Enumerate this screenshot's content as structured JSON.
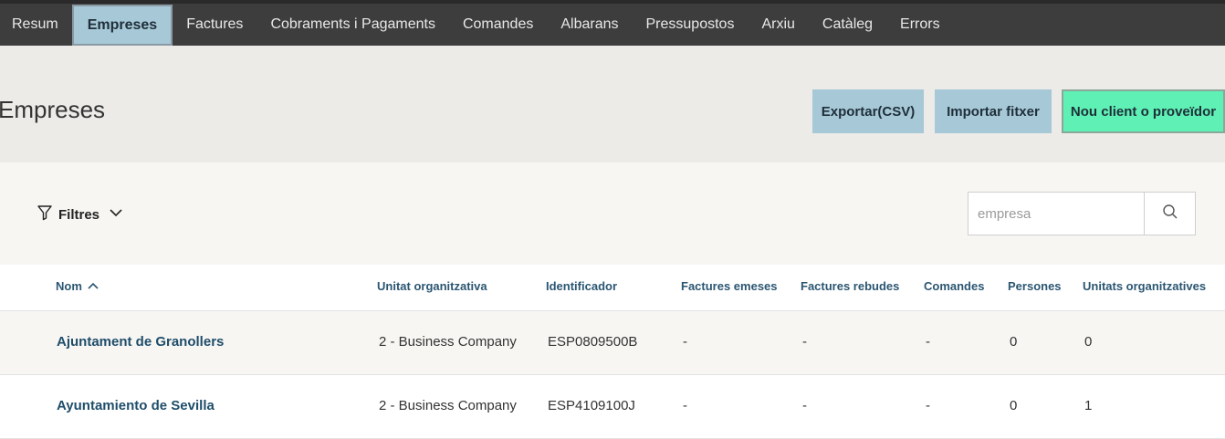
{
  "nav": {
    "items": [
      {
        "label": "Resum"
      },
      {
        "label": "Empreses"
      },
      {
        "label": "Factures"
      },
      {
        "label": "Cobraments i Pagaments"
      },
      {
        "label": "Comandes"
      },
      {
        "label": "Albarans"
      },
      {
        "label": "Pressupostos"
      },
      {
        "label": "Arxiu"
      },
      {
        "label": "Catàleg"
      },
      {
        "label": "Errors"
      }
    ],
    "active": "Empreses"
  },
  "header": {
    "title": "Empreses",
    "export_label": "Exportar(CSV)",
    "import_label": "Importar fitxer",
    "new_label": "Nou client o proveïdor"
  },
  "filters": {
    "label": "Filtres",
    "search_placeholder": "empresa"
  },
  "table": {
    "columns": [
      {
        "label": "Nom"
      },
      {
        "label": "Unitat organitzativa"
      },
      {
        "label": "Identificador"
      },
      {
        "label": "Factures emeses"
      },
      {
        "label": "Factures rebudes"
      },
      {
        "label": "Comandes"
      },
      {
        "label": "Persones"
      },
      {
        "label": "Unitats organitzatives"
      }
    ],
    "rows": [
      {
        "nom": "Ajuntament de Granollers",
        "unitat": "2 - Business Company",
        "id": "ESP0809500B",
        "emeses": "-",
        "rebudes": "-",
        "comandes": "-",
        "persones": "0",
        "unitats": "0"
      },
      {
        "nom": "Ayuntamiento de Sevilla",
        "unitat": "2 - Business Company",
        "id": "ESP4109100J",
        "emeses": "-",
        "rebudes": "-",
        "comandes": "-",
        "persones": "0",
        "unitats": "1"
      }
    ]
  },
  "colors": {
    "topbar": "#3d3d3d",
    "accent_blue": "#a7c8d6",
    "accent_green": "#5ef0b4",
    "link": "#1f4d6a"
  }
}
